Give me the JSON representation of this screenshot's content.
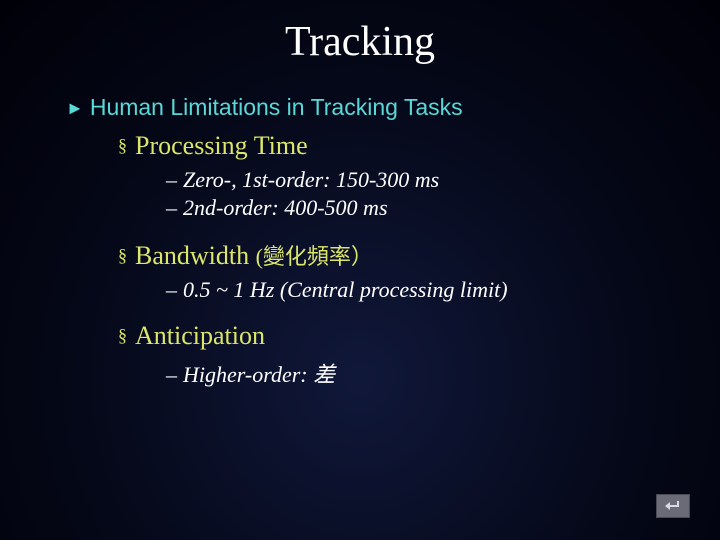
{
  "title": "Tracking",
  "heading": "Human Limitations in Tracking Tasks",
  "sections": [
    {
      "label": "Processing Time",
      "paren": "",
      "items": [
        "Zero-, 1st-order: 150-300 ms",
        "2nd-order: 400-500 ms"
      ]
    },
    {
      "label": "Bandwidth",
      "paren": "(變化頻率）",
      "items": [
        "0.5 ~ 1 Hz (Central processing limit)"
      ]
    },
    {
      "label": "Anticipation",
      "paren": "",
      "items": [
        "Higher-order: 差"
      ]
    }
  ]
}
